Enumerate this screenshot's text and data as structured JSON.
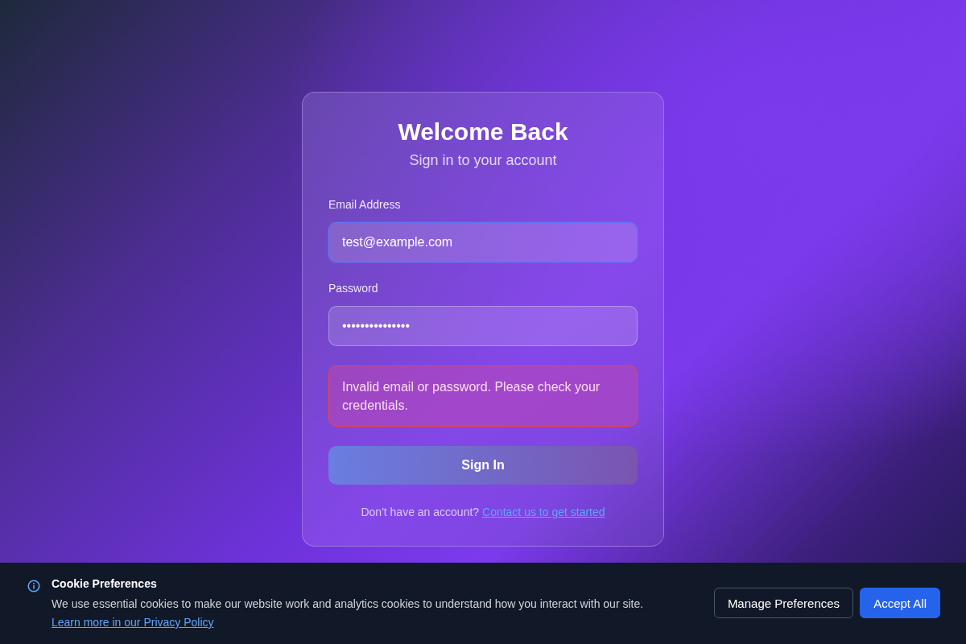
{
  "login": {
    "title": "Welcome Back",
    "subtitle": "Sign in to your account",
    "fields": [
      {
        "label": "Email Address",
        "value": "test@example.com",
        "focused": true
      },
      {
        "label": "Password",
        "value": "•••••••••••••••",
        "focused": false
      }
    ],
    "error": "Invalid email or password. Please check your credentials.",
    "submit": "Sign In",
    "footer": {
      "text": "Don't have an account?",
      "link": "Contact us to get started"
    }
  },
  "cookie_banner": {
    "title": "Cookie Preferences",
    "text": "We use essential cookies to make our website work and analytics cookies to understand how you interact with our site.",
    "link": "Learn more in our Privacy Policy",
    "buttons": [
      {
        "label": "Manage Preferences",
        "kind": "secondary"
      },
      {
        "label": "Accept All",
        "kind": "primary"
      }
    ]
  }
}
